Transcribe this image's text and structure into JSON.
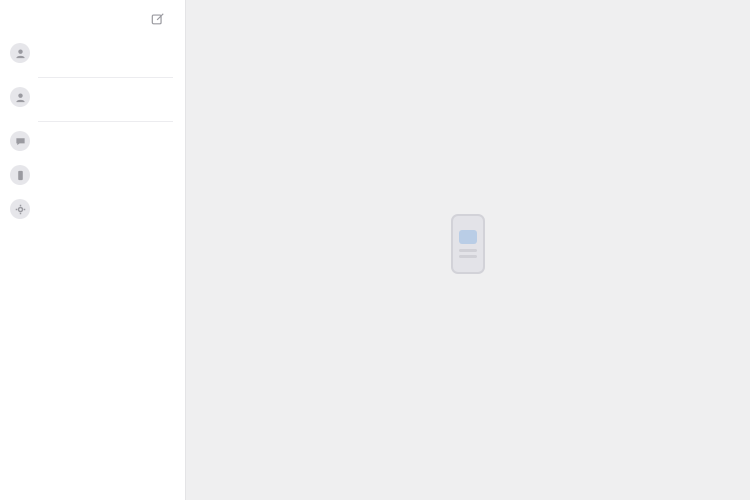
{
  "sidebar": {
    "edit_icon": "compose-icon",
    "items": [
      {
        "title": "",
        "subtitle": "",
        "icon": "person-icon"
      },
      {
        "title": "",
        "subtitle": "",
        "icon": "person-icon"
      },
      {
        "title": "",
        "icon": "chat-icon"
      },
      {
        "title": "",
        "icon": "phone-icon"
      },
      {
        "title": "",
        "icon": "settings-icon"
      }
    ]
  },
  "main": {
    "empty_state": {
      "icon": "phone-device-icon",
      "title": "",
      "description": ""
    }
  },
  "colors": {
    "sidebar_bg": "#ffffff",
    "main_bg": "#efeff0",
    "accent": "#b9cde6"
  }
}
